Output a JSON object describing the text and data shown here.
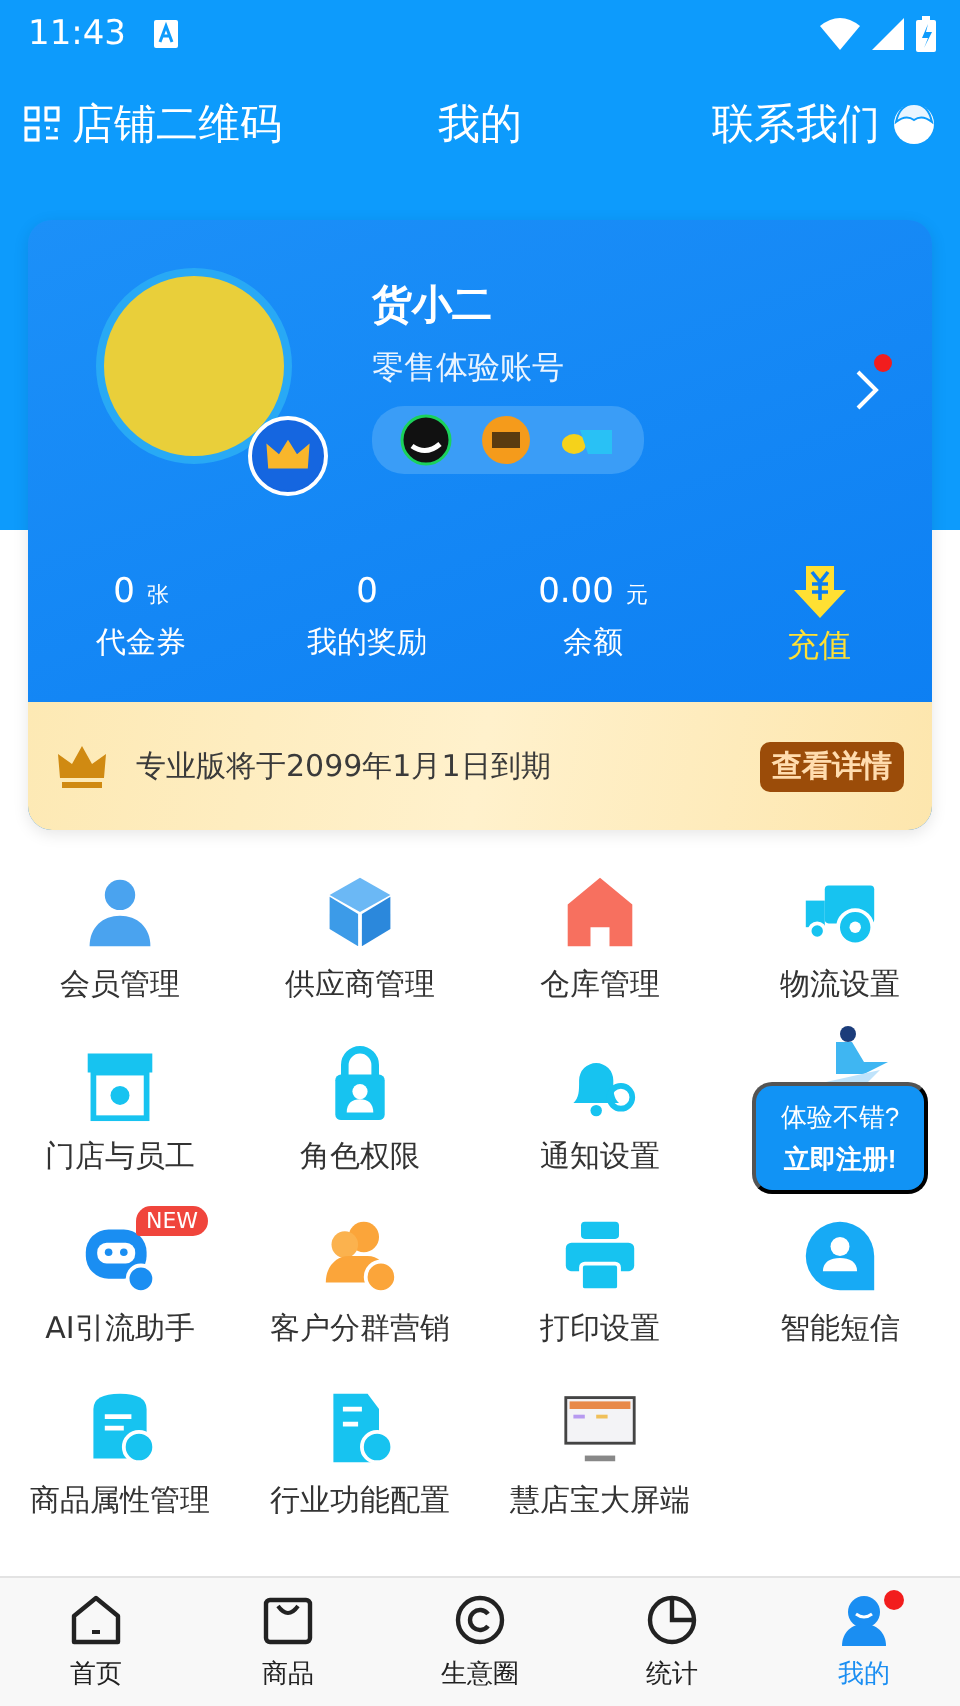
{
  "status_bar": {
    "time": "11:43"
  },
  "header": {
    "left": "店铺二维码",
    "title": "我的",
    "right": "联系我们"
  },
  "profile": {
    "name": "货小二",
    "subtitle": "零售体验账号",
    "has_notice": true
  },
  "stats": [
    {
      "kind": "value",
      "value": "0",
      "unit": "张",
      "label": "代金券"
    },
    {
      "kind": "value",
      "value": "0",
      "label": "我的奖励"
    },
    {
      "kind": "value",
      "value": "0.00",
      "unit": "元",
      "label": "余额"
    },
    {
      "kind": "action",
      "label": "充值"
    }
  ],
  "banner": {
    "text": "专业版将于2099年1月1日到期",
    "button": "查看详情"
  },
  "grid": [
    {
      "kind": "member",
      "label": "会员管理"
    },
    {
      "kind": "box",
      "label": "供应商管理"
    },
    {
      "kind": "house",
      "label": "仓库管理"
    },
    {
      "kind": "truck",
      "label": "物流设置"
    },
    {
      "kind": "store",
      "label": "门店与员工"
    },
    {
      "kind": "lock",
      "label": "角色权限"
    },
    {
      "kind": "bell",
      "label": "通知设置"
    },
    {
      "kind": "empty"
    },
    {
      "kind": "robot",
      "label": "AI引流助手",
      "badge": "NEW"
    },
    {
      "kind": "group",
      "label": "客户分群营销"
    },
    {
      "kind": "printer",
      "label": "打印设置"
    },
    {
      "kind": "chat",
      "label": "智能短信"
    },
    {
      "kind": "bag",
      "label": "商品属性管理"
    },
    {
      "kind": "doc",
      "label": "行业功能配置"
    },
    {
      "kind": "monitor",
      "label": "慧店宝大屏端"
    }
  ],
  "promo": {
    "lines": [
      "体验不错?",
      "立即注册!"
    ]
  },
  "tabs": [
    {
      "label": "首页",
      "selected": false,
      "badge": false
    },
    {
      "label": "商品",
      "selected": false,
      "badge": false
    },
    {
      "label": "生意圈",
      "selected": false,
      "badge": false
    },
    {
      "label": "统计",
      "selected": false,
      "badge": false
    },
    {
      "label": "我的",
      "selected": true,
      "badge": true
    }
  ]
}
